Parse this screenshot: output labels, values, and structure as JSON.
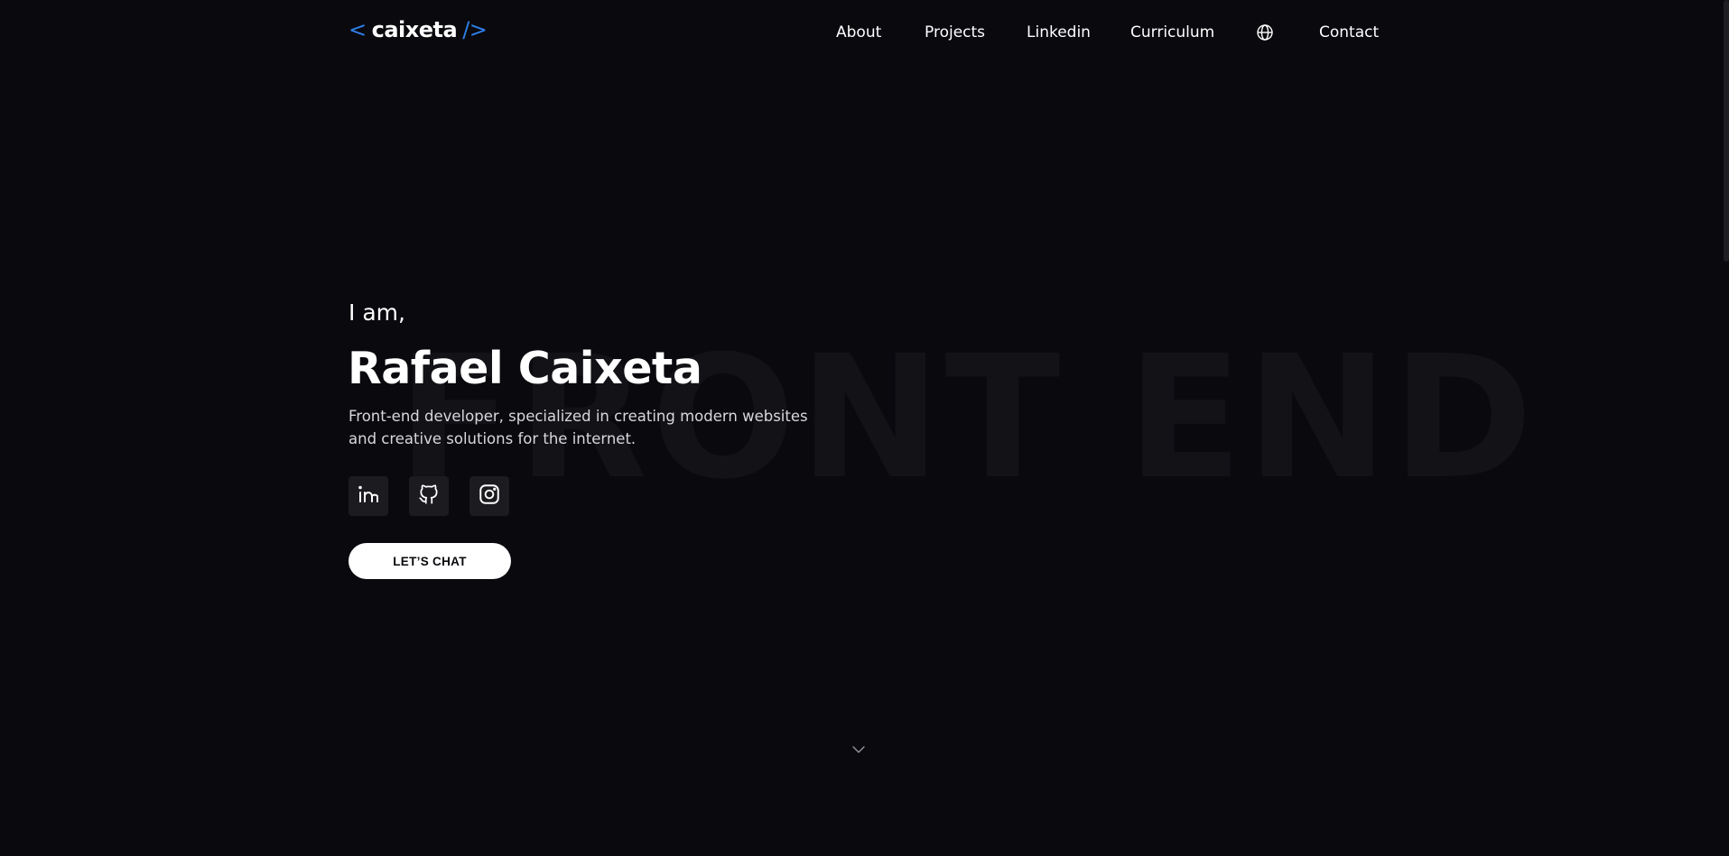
{
  "logo": {
    "open": "<",
    "name": "caixeta",
    "close": "/>"
  },
  "nav": {
    "items": [
      {
        "label": "About"
      },
      {
        "label": "Projects"
      },
      {
        "label": "Linkedin"
      },
      {
        "label": "Curriculum"
      },
      {
        "label": "Contact"
      }
    ],
    "language_icon": "globe-icon"
  },
  "hero": {
    "greeting": "I am,",
    "name": "Rafael Caixeta",
    "description": "Front-end developer, specialized in creating modern websites and creative solutions for the internet.",
    "watermark": "FRONT END",
    "socials": [
      {
        "icon": "linkedin-icon"
      },
      {
        "icon": "github-icon"
      },
      {
        "icon": "instagram-icon"
      }
    ],
    "cta_label": "LET’S CHAT",
    "scroll_icon": "chevron-down-icon"
  },
  "colors": {
    "background": "#09090e",
    "accent": "#2f7fe6",
    "text": "#ffffff",
    "button_bg": "#ffffff",
    "social_bg": "#1b1b20"
  }
}
